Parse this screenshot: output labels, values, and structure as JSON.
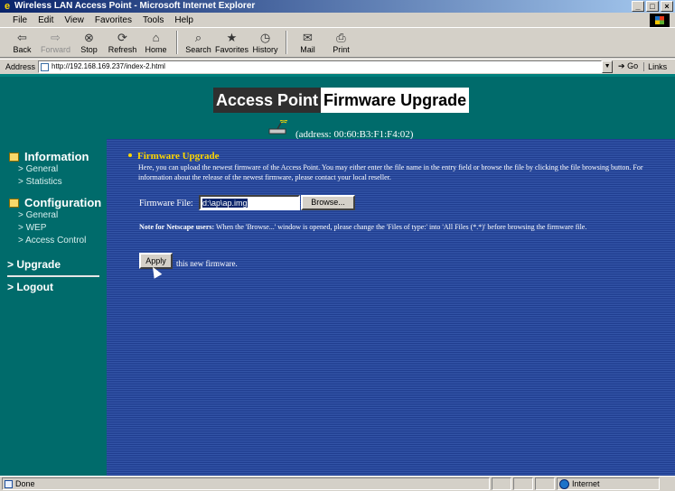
{
  "window": {
    "title": "Wireless LAN Access Point - Microsoft Internet Explorer",
    "controls": [
      "_",
      "□",
      "×"
    ]
  },
  "menu": [
    "File",
    "Edit",
    "View",
    "Favorites",
    "Tools",
    "Help"
  ],
  "toolbar": [
    {
      "label": "Back",
      "icon": "back-arrow-icon",
      "glyph": "⇦"
    },
    {
      "label": "Forward",
      "icon": "forward-arrow-icon",
      "glyph": "⇨"
    },
    {
      "label": "Stop",
      "icon": "stop-icon",
      "glyph": "⊗"
    },
    {
      "label": "Refresh",
      "icon": "refresh-icon",
      "glyph": "⟳"
    },
    {
      "label": "Home",
      "icon": "home-icon",
      "glyph": "⌂"
    },
    {
      "label": "Search",
      "icon": "search-icon",
      "glyph": "⌕"
    },
    {
      "label": "Favorites",
      "icon": "favorites-icon",
      "glyph": "★"
    },
    {
      "label": "History",
      "icon": "history-icon",
      "glyph": "◷"
    },
    {
      "label": "Mail",
      "icon": "mail-icon",
      "glyph": "✉"
    },
    {
      "label": "Print",
      "icon": "print-icon",
      "glyph": "⎙"
    }
  ],
  "address": {
    "label": "Address",
    "url": "http://192.168.169.237/index-2.html",
    "go": "Go",
    "links": "Links"
  },
  "banner": {
    "part1": "Access Point",
    "part2": "Firmware Upgrade"
  },
  "device_address": "(address: 00:60:B3:F1:F4:02)",
  "sidebar": {
    "information": "Information",
    "info_items": [
      "> General",
      "> Statistics"
    ],
    "configuration": "Configuration",
    "config_items": [
      "> General",
      "> WEP",
      "> Access Control"
    ],
    "upgrade": "> Upgrade",
    "logout": "> Logout"
  },
  "main": {
    "title": "Firmware Upgrade",
    "description": "Here, you can upload the newest firmware of the Access Point. You may either enter the file name in the entry field or browse the file by clicking the file browsing button. For information about the release of the newest firmware, please contact your local reseller.",
    "firmware_label": "Firmware File:",
    "firmware_value": "d:\\ap\\ap.img",
    "browse": "Browse...",
    "note_bold": "Note for Netscape users:",
    "note_text": "When the 'Browse...' window is opened, please change the 'Files of type:' into 'All Files (*.*)' before browsing the firmware file.",
    "apply": "Apply",
    "apply_text": "this new firmware."
  },
  "status": {
    "left": "Done",
    "zone": "Internet"
  },
  "colors": {
    "background": "#006b6b",
    "panel_stripe_dark": "#1f3d8f",
    "panel_stripe_light": "#3455a8",
    "title_yellow": "#ffd800"
  }
}
